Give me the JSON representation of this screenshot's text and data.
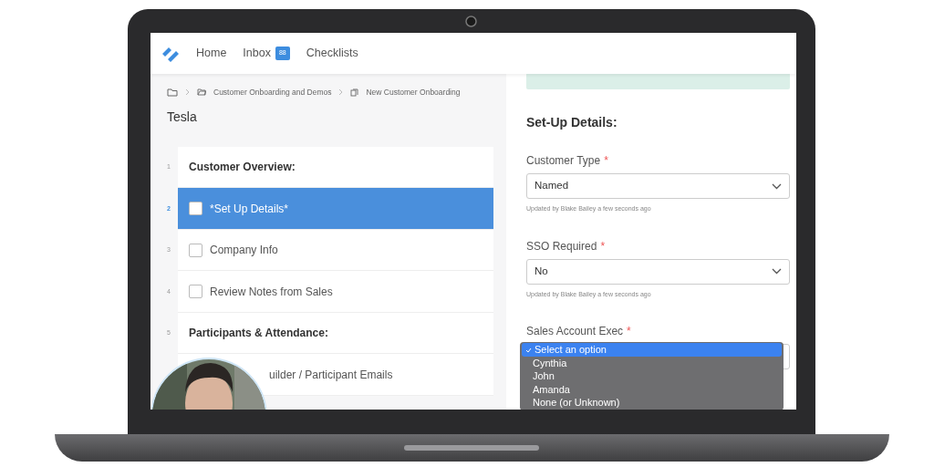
{
  "nav": {
    "items": [
      {
        "label": "Home"
      },
      {
        "label": "Inbox",
        "badge": "88"
      },
      {
        "label": "Checklists"
      }
    ]
  },
  "breadcrumb": {
    "items": [
      {
        "label": "Customer Onboarding and Demos"
      },
      {
        "label": "New Customer Onboarding"
      }
    ]
  },
  "title": "Tesla",
  "tasks": [
    {
      "number": "1",
      "kind": "heading",
      "label": "Customer Overview:",
      "selected": false
    },
    {
      "number": "2",
      "kind": "task",
      "label": "*Set Up Details*",
      "selected": true,
      "checked": false
    },
    {
      "number": "3",
      "kind": "task",
      "label": "Company Info",
      "selected": false,
      "checked": false
    },
    {
      "number": "4",
      "kind": "task",
      "label": "Review Notes from Sales",
      "selected": false,
      "checked": false
    },
    {
      "number": "5",
      "kind": "heading",
      "label": "Participants & Attendance:",
      "selected": false
    },
    {
      "kind": "task",
      "label": "uilder / Participant Emails",
      "selected": false
    }
  ],
  "form": {
    "heading": "Set-Up Details:",
    "fields": [
      {
        "label": "Customer Type",
        "required_mark": "*",
        "value": "Named",
        "note": "Updated by Blake Bailey a few seconds ago"
      },
      {
        "label": "SSO Required",
        "required_mark": "*",
        "value": "No",
        "note": "Updated by Blake Bailey a few seconds ago"
      },
      {
        "label": "Sales Account Exec",
        "required_mark": "*",
        "expanded": true,
        "options": [
          {
            "label": "Select an option",
            "selected": true
          },
          {
            "label": "Cynthia",
            "selected": false
          },
          {
            "label": "John",
            "selected": false
          },
          {
            "label": "Amanda",
            "selected": false
          },
          {
            "label": "None (or Unknown)",
            "selected": false
          }
        ]
      }
    ]
  }
}
